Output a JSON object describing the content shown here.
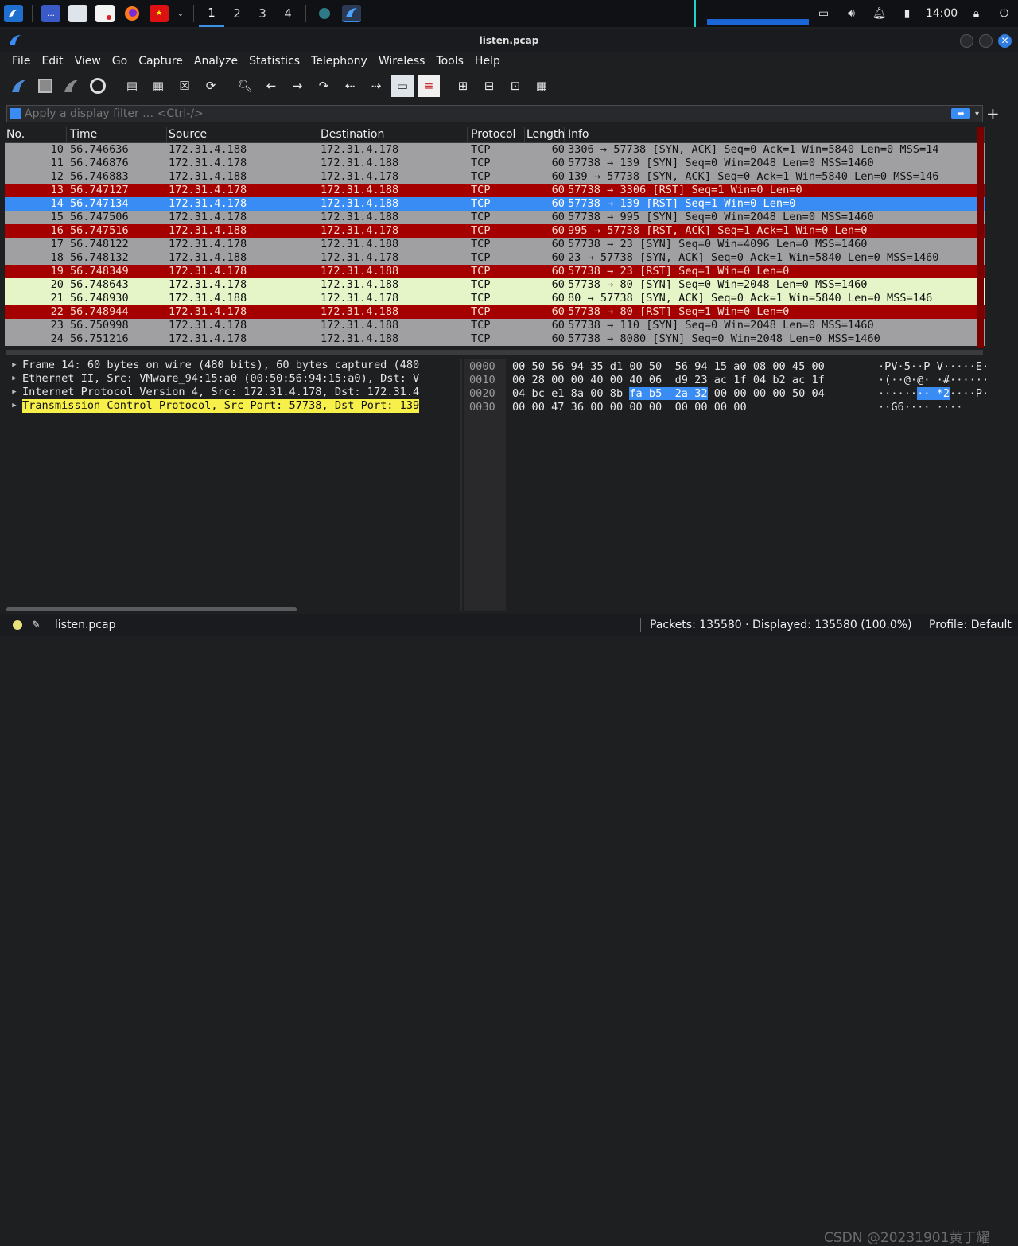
{
  "taskbar": {
    "workspaces": [
      "1",
      "2",
      "3",
      "4"
    ],
    "clock": "14:00"
  },
  "window": {
    "title": "listen.pcap"
  },
  "menu": [
    "File",
    "Edit",
    "View",
    "Go",
    "Capture",
    "Analyze",
    "Statistics",
    "Telephony",
    "Wireless",
    "Tools",
    "Help"
  ],
  "filter": {
    "placeholder": "Apply a display filter … <Ctrl-/>"
  },
  "columns": [
    "No.",
    "Time",
    "Source",
    "Destination",
    "Protocol",
    "Length",
    "Info"
  ],
  "packets": [
    {
      "no": "10",
      "time": "56.746636",
      "src": "172.31.4.188",
      "dst": "172.31.4.178",
      "proto": "TCP",
      "len": "60",
      "info": "3306 → 57738 [SYN, ACK] Seq=0 Ack=1 Win=5840 Len=0 MSS=14",
      "color": "gray"
    },
    {
      "no": "11",
      "time": "56.746876",
      "src": "172.31.4.178",
      "dst": "172.31.4.188",
      "proto": "TCP",
      "len": "60",
      "info": "57738 → 139 [SYN] Seq=0 Win=2048 Len=0 MSS=1460",
      "color": "gray"
    },
    {
      "no": "12",
      "time": "56.746883",
      "src": "172.31.4.188",
      "dst": "172.31.4.178",
      "proto": "TCP",
      "len": "60",
      "info": "139 → 57738 [SYN, ACK] Seq=0 Ack=1 Win=5840 Len=0 MSS=146",
      "color": "gray"
    },
    {
      "no": "13",
      "time": "56.747127",
      "src": "172.31.4.178",
      "dst": "172.31.4.188",
      "proto": "TCP",
      "len": "60",
      "info": "57738 → 3306 [RST] Seq=1 Win=0 Len=0",
      "color": "red"
    },
    {
      "no": "14",
      "time": "56.747134",
      "src": "172.31.4.178",
      "dst": "172.31.4.188",
      "proto": "TCP",
      "len": "60",
      "info": "57738 → 139 [RST] Seq=1 Win=0 Len=0",
      "color": "sel"
    },
    {
      "no": "15",
      "time": "56.747506",
      "src": "172.31.4.178",
      "dst": "172.31.4.188",
      "proto": "TCP",
      "len": "60",
      "info": "57738 → 995 [SYN] Seq=0 Win=2048 Len=0 MSS=1460",
      "color": "gray"
    },
    {
      "no": "16",
      "time": "56.747516",
      "src": "172.31.4.188",
      "dst": "172.31.4.178",
      "proto": "TCP",
      "len": "60",
      "info": "995 → 57738 [RST, ACK] Seq=1 Ack=1 Win=0 Len=0",
      "color": "red"
    },
    {
      "no": "17",
      "time": "56.748122",
      "src": "172.31.4.178",
      "dst": "172.31.4.188",
      "proto": "TCP",
      "len": "60",
      "info": "57738 → 23 [SYN] Seq=0 Win=4096 Len=0 MSS=1460",
      "color": "gray"
    },
    {
      "no": "18",
      "time": "56.748132",
      "src": "172.31.4.188",
      "dst": "172.31.4.178",
      "proto": "TCP",
      "len": "60",
      "info": "23 → 57738 [SYN, ACK] Seq=0 Ack=1 Win=5840 Len=0 MSS=1460",
      "color": "gray"
    },
    {
      "no": "19",
      "time": "56.748349",
      "src": "172.31.4.178",
      "dst": "172.31.4.188",
      "proto": "TCP",
      "len": "60",
      "info": "57738 → 23 [RST] Seq=1 Win=0 Len=0",
      "color": "red"
    },
    {
      "no": "20",
      "time": "56.748643",
      "src": "172.31.4.178",
      "dst": "172.31.4.188",
      "proto": "TCP",
      "len": "60",
      "info": "57738 → 80 [SYN] Seq=0 Win=2048 Len=0 MSS=1460",
      "color": "green"
    },
    {
      "no": "21",
      "time": "56.748930",
      "src": "172.31.4.188",
      "dst": "172.31.4.178",
      "proto": "TCP",
      "len": "60",
      "info": "80 → 57738 [SYN, ACK] Seq=0 Ack=1 Win=5840 Len=0 MSS=146",
      "color": "green"
    },
    {
      "no": "22",
      "time": "56.748944",
      "src": "172.31.4.178",
      "dst": "172.31.4.188",
      "proto": "TCP",
      "len": "60",
      "info": "57738 → 80 [RST] Seq=1 Win=0 Len=0",
      "color": "red"
    },
    {
      "no": "23",
      "time": "56.750998",
      "src": "172.31.4.178",
      "dst": "172.31.4.188",
      "proto": "TCP",
      "len": "60",
      "info": "57738 → 110 [SYN] Seq=0 Win=2048 Len=0 MSS=1460",
      "color": "gray"
    },
    {
      "no": "24",
      "time": "56.751216",
      "src": "172.31.4.178",
      "dst": "172.31.4.188",
      "proto": "TCP",
      "len": "60",
      "info": "57738 → 8080 [SYN] Seq=0 Win=2048 Len=0 MSS=1460",
      "color": "gray"
    }
  ],
  "details": [
    "Frame 14: 60 bytes on wire (480 bits), 60 bytes captured (480",
    "Ethernet II, Src: VMware_94:15:a0 (00:50:56:94:15:a0), Dst: V",
    "Internet Protocol Version 4, Src: 172.31.4.178, Dst: 172.31.4",
    "Transmission Control Protocol, Src Port: 57738, Dst Port: 139"
  ],
  "bytes": [
    {
      "offset": "0000",
      "hex_pre": "00 50 56 94 35 d1 00 50  56 94 15 a0 08 00 45 00",
      "hex_sel": "",
      "hex_post": "",
      "ascii_pre": "·PV·5··P V·····E·",
      "ascii_sel": "",
      "ascii_post": ""
    },
    {
      "offset": "0010",
      "hex_pre": "00 28 00 00 40 00 40 06  d9 23 ac 1f 04 b2 ac 1f",
      "hex_sel": "",
      "hex_post": "",
      "ascii_pre": "·(··@·@· ·#······",
      "ascii_sel": "",
      "ascii_post": ""
    },
    {
      "offset": "0020",
      "hex_pre": "04 bc e1 8a 00 8b ",
      "hex_sel": "fa b5  2a 32",
      "hex_post": " 00 00 00 00 50 04",
      "ascii_pre": "······",
      "ascii_sel": "·· *2",
      "ascii_post": "····P·"
    },
    {
      "offset": "0030",
      "hex_pre": "00 00 47 36 00 00 00 00  00 00 00 00",
      "hex_sel": "",
      "hex_post": "",
      "ascii_pre": "··G6···· ····",
      "ascii_sel": "",
      "ascii_post": ""
    }
  ],
  "status": {
    "file": "listen.pcap",
    "packets": "Packets: 135580 · Displayed: 135580 (100.0%)",
    "profile": "Profile: Default",
    "watermark": "CSDN @20231901黄丁耀"
  },
  "colors": {
    "red_row": "#a40000",
    "gray_row": "#a0a0a2",
    "selected_row": "#3a8cf5",
    "green_row": "#e6f5c8",
    "highlight": "#f7ef4a"
  }
}
